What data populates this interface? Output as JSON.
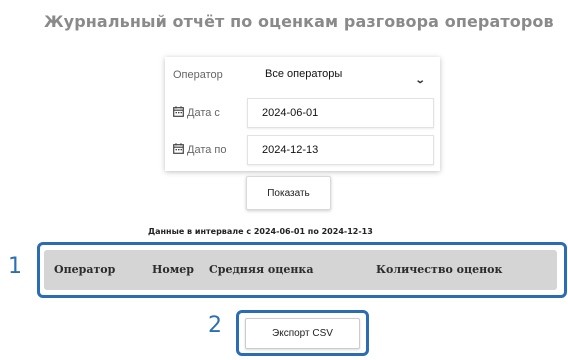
{
  "page_title": "Журнальный отчёт по оценкам разговора операторов",
  "form": {
    "operator_label": "Оператор",
    "operator_value": "Все операторы",
    "date_from_label": "Дата с",
    "date_from_value": "2024-06-01",
    "date_to_label": "Дата по",
    "date_to_value": "2024-12-13",
    "calendar_icon": "calendar-icon",
    "dropdown_icon": "chevron-down-icon"
  },
  "show_button_label": "Показать",
  "range_text": "Данные в интервале с 2024-06-01 по 2024-12-13",
  "table": {
    "columns": [
      "Оператор",
      "Номер",
      "Средняя оценка",
      "Количество оценок"
    ]
  },
  "export_button_label": "Экспорт CSV",
  "callouts": [
    "1",
    "2"
  ],
  "colors": {
    "highlight": "#2b6cb3",
    "table_header_bg": "#d5d5d5",
    "title": "#8a8a8a"
  }
}
